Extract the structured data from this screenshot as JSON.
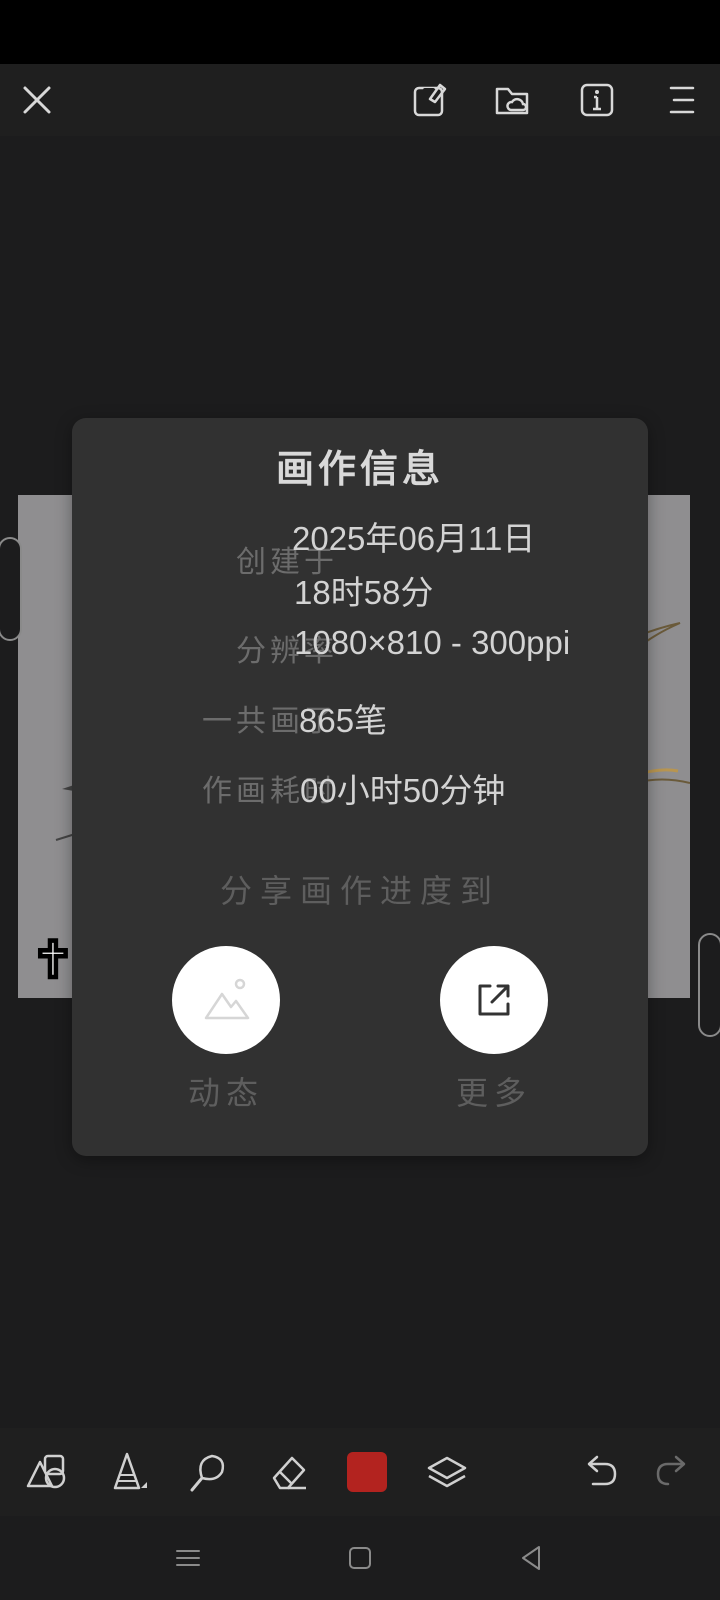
{
  "top_bar": {
    "icons": [
      "close-icon",
      "edit-canvas-icon",
      "cloud-folder-icon",
      "info-icon",
      "menu-icon"
    ]
  },
  "dialog": {
    "title": "画作信息",
    "rows": [
      {
        "label": "创建于",
        "value_line1": "2025年06月11日",
        "value_line2": "18时58分"
      },
      {
        "label": "分辨率",
        "value": "1080×810 - 300ppi"
      },
      {
        "label": "一共画了",
        "value": "865笔"
      },
      {
        "label": "作画耗时",
        "value": "00小时50分钟"
      }
    ],
    "share_title": "分享画作进度到",
    "share_options": [
      {
        "label": "动态",
        "icon": "image-mountain-icon"
      },
      {
        "label": "更多",
        "icon": "external-share-icon"
      }
    ]
  },
  "artwork": {
    "sticker": "✝"
  },
  "toolbar": {
    "tools": [
      "shapes-icon",
      "pen-nib-icon",
      "smudge-brush-icon",
      "eraser-icon",
      "color-swatch",
      "layers-icon",
      "undo-icon",
      "redo-icon"
    ],
    "current_color": "#b3231f"
  },
  "nav": {
    "buttons": [
      "recents-icon",
      "home-icon",
      "back-icon"
    ]
  }
}
